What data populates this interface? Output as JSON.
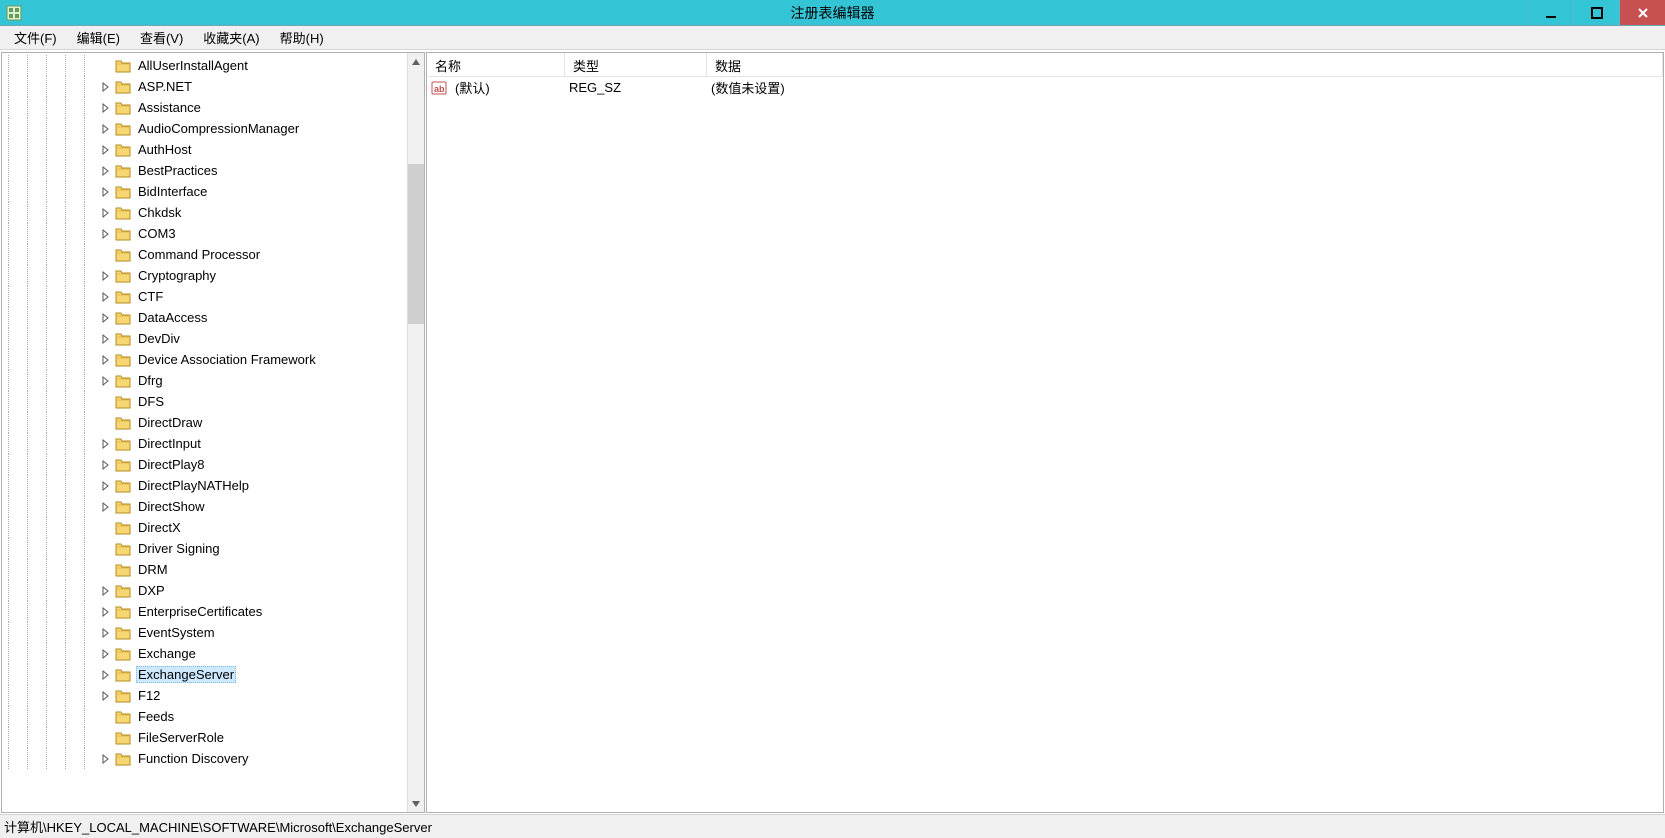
{
  "window": {
    "title": "注册表编辑器"
  },
  "menubar": {
    "items": [
      {
        "label": "文件(F)"
      },
      {
        "label": "编辑(E)"
      },
      {
        "label": "查看(V)"
      },
      {
        "label": "收藏夹(A)"
      },
      {
        "label": "帮助(H)"
      }
    ]
  },
  "tree": {
    "items": [
      {
        "label": "AllUserInstallAgent",
        "toggle": "none"
      },
      {
        "label": "ASP.NET",
        "toggle": "closed"
      },
      {
        "label": "Assistance",
        "toggle": "closed"
      },
      {
        "label": "AudioCompressionManager",
        "toggle": "closed"
      },
      {
        "label": "AuthHost",
        "toggle": "closed"
      },
      {
        "label": "BestPractices",
        "toggle": "closed"
      },
      {
        "label": "BidInterface",
        "toggle": "closed"
      },
      {
        "label": "Chkdsk",
        "toggle": "closed"
      },
      {
        "label": "COM3",
        "toggle": "closed"
      },
      {
        "label": "Command Processor",
        "toggle": "none"
      },
      {
        "label": "Cryptography",
        "toggle": "closed"
      },
      {
        "label": "CTF",
        "toggle": "closed"
      },
      {
        "label": "DataAccess",
        "toggle": "closed"
      },
      {
        "label": "DevDiv",
        "toggle": "closed"
      },
      {
        "label": "Device Association Framework",
        "toggle": "closed"
      },
      {
        "label": "Dfrg",
        "toggle": "closed"
      },
      {
        "label": "DFS",
        "toggle": "none"
      },
      {
        "label": "DirectDraw",
        "toggle": "none"
      },
      {
        "label": "DirectInput",
        "toggle": "closed"
      },
      {
        "label": "DirectPlay8",
        "toggle": "closed"
      },
      {
        "label": "DirectPlayNATHelp",
        "toggle": "closed"
      },
      {
        "label": "DirectShow",
        "toggle": "closed"
      },
      {
        "label": "DirectX",
        "toggle": "none"
      },
      {
        "label": "Driver Signing",
        "toggle": "none"
      },
      {
        "label": "DRM",
        "toggle": "none"
      },
      {
        "label": "DXP",
        "toggle": "closed"
      },
      {
        "label": "EnterpriseCertificates",
        "toggle": "closed"
      },
      {
        "label": "EventSystem",
        "toggle": "closed"
      },
      {
        "label": "Exchange",
        "toggle": "closed"
      },
      {
        "label": "ExchangeServer",
        "toggle": "closed",
        "selected": true
      },
      {
        "label": "F12",
        "toggle": "closed"
      },
      {
        "label": "Feeds",
        "toggle": "none"
      },
      {
        "label": "FileServerRole",
        "toggle": "none"
      },
      {
        "label": "Function Discovery",
        "toggle": "closed"
      }
    ]
  },
  "list": {
    "columns": {
      "name": "名称",
      "type": "类型",
      "data": "数据"
    },
    "rows": [
      {
        "name": "(默认)",
        "type": "REG_SZ",
        "data": "(数值未设置)"
      }
    ]
  },
  "statusbar": {
    "path": "计算机\\HKEY_LOCAL_MACHINE\\SOFTWARE\\Microsoft\\ExchangeServer"
  },
  "scrollbar": {
    "thumb_top_pct": 13,
    "thumb_height_pct": 22
  }
}
